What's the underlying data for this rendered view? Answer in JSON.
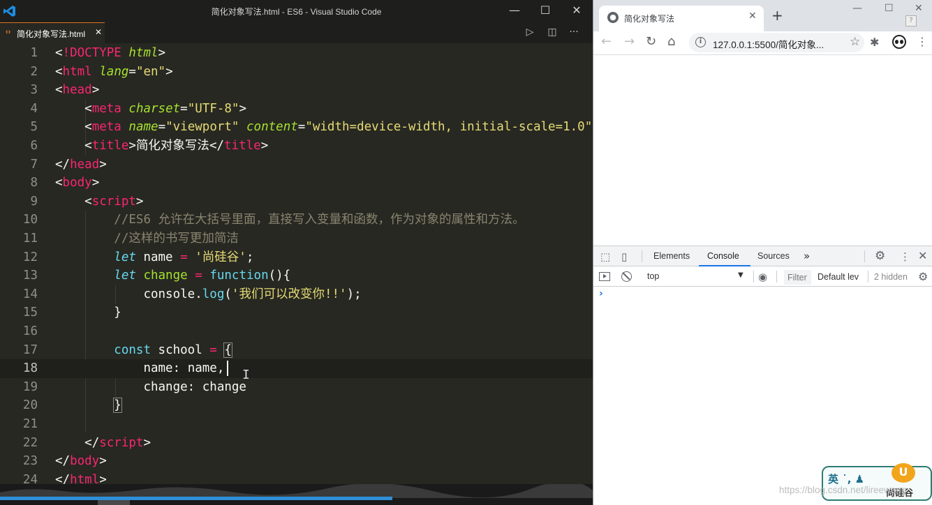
{
  "vscode": {
    "window_title": "简化对象写法.html - ES6 - Visual Studio Code",
    "window_controls": {
      "minimize": "—",
      "maximize": "☐",
      "close": "✕"
    },
    "tab": {
      "label": "简化对象写法.html",
      "icon": "‹›",
      "close": "✕"
    },
    "actions": {
      "run": "▷",
      "split": "◫",
      "more": "···"
    },
    "cursor_line": 18,
    "lines": [
      "1",
      "2",
      "3",
      "4",
      "5",
      "6",
      "7",
      "8",
      "9",
      "10",
      "11",
      "12",
      "13",
      "14",
      "15",
      "16",
      "17",
      "18",
      "19",
      "20",
      "21",
      "22",
      "23",
      "24"
    ]
  },
  "chrome": {
    "tab_title": "简化对象写法",
    "tab_close": "✕",
    "new_tab": "+",
    "window_controls": {
      "minimize": "—",
      "maximize": "☐",
      "close": "✕",
      "help": "?"
    },
    "nav": {
      "back": "←",
      "forward": "→",
      "reload": "↻",
      "home": "⌂"
    },
    "url": "127.0.0.1:5500/简化对象...",
    "star": "☆",
    "extensions": "✱",
    "menu": "⋮"
  },
  "devtools": {
    "tabs": [
      "Elements",
      "Console",
      "Sources"
    ],
    "active_tab": "Console",
    "more_tabs": "»",
    "gear": "⚙",
    "kebab": "⋮",
    "close": "✕",
    "context": "top",
    "context_arrow": "▼",
    "eye": "◉",
    "filter_placeholder": "Filter",
    "levels": "Default lev",
    "hidden": "2 hidden",
    "settings": "⚙",
    "prompt": "›"
  },
  "ime": {
    "text": "英 ˙, ♟",
    "brand": "尚硅谷",
    "logo": "U"
  },
  "watermark": "https://blog.csdn.net/lireewang"
}
